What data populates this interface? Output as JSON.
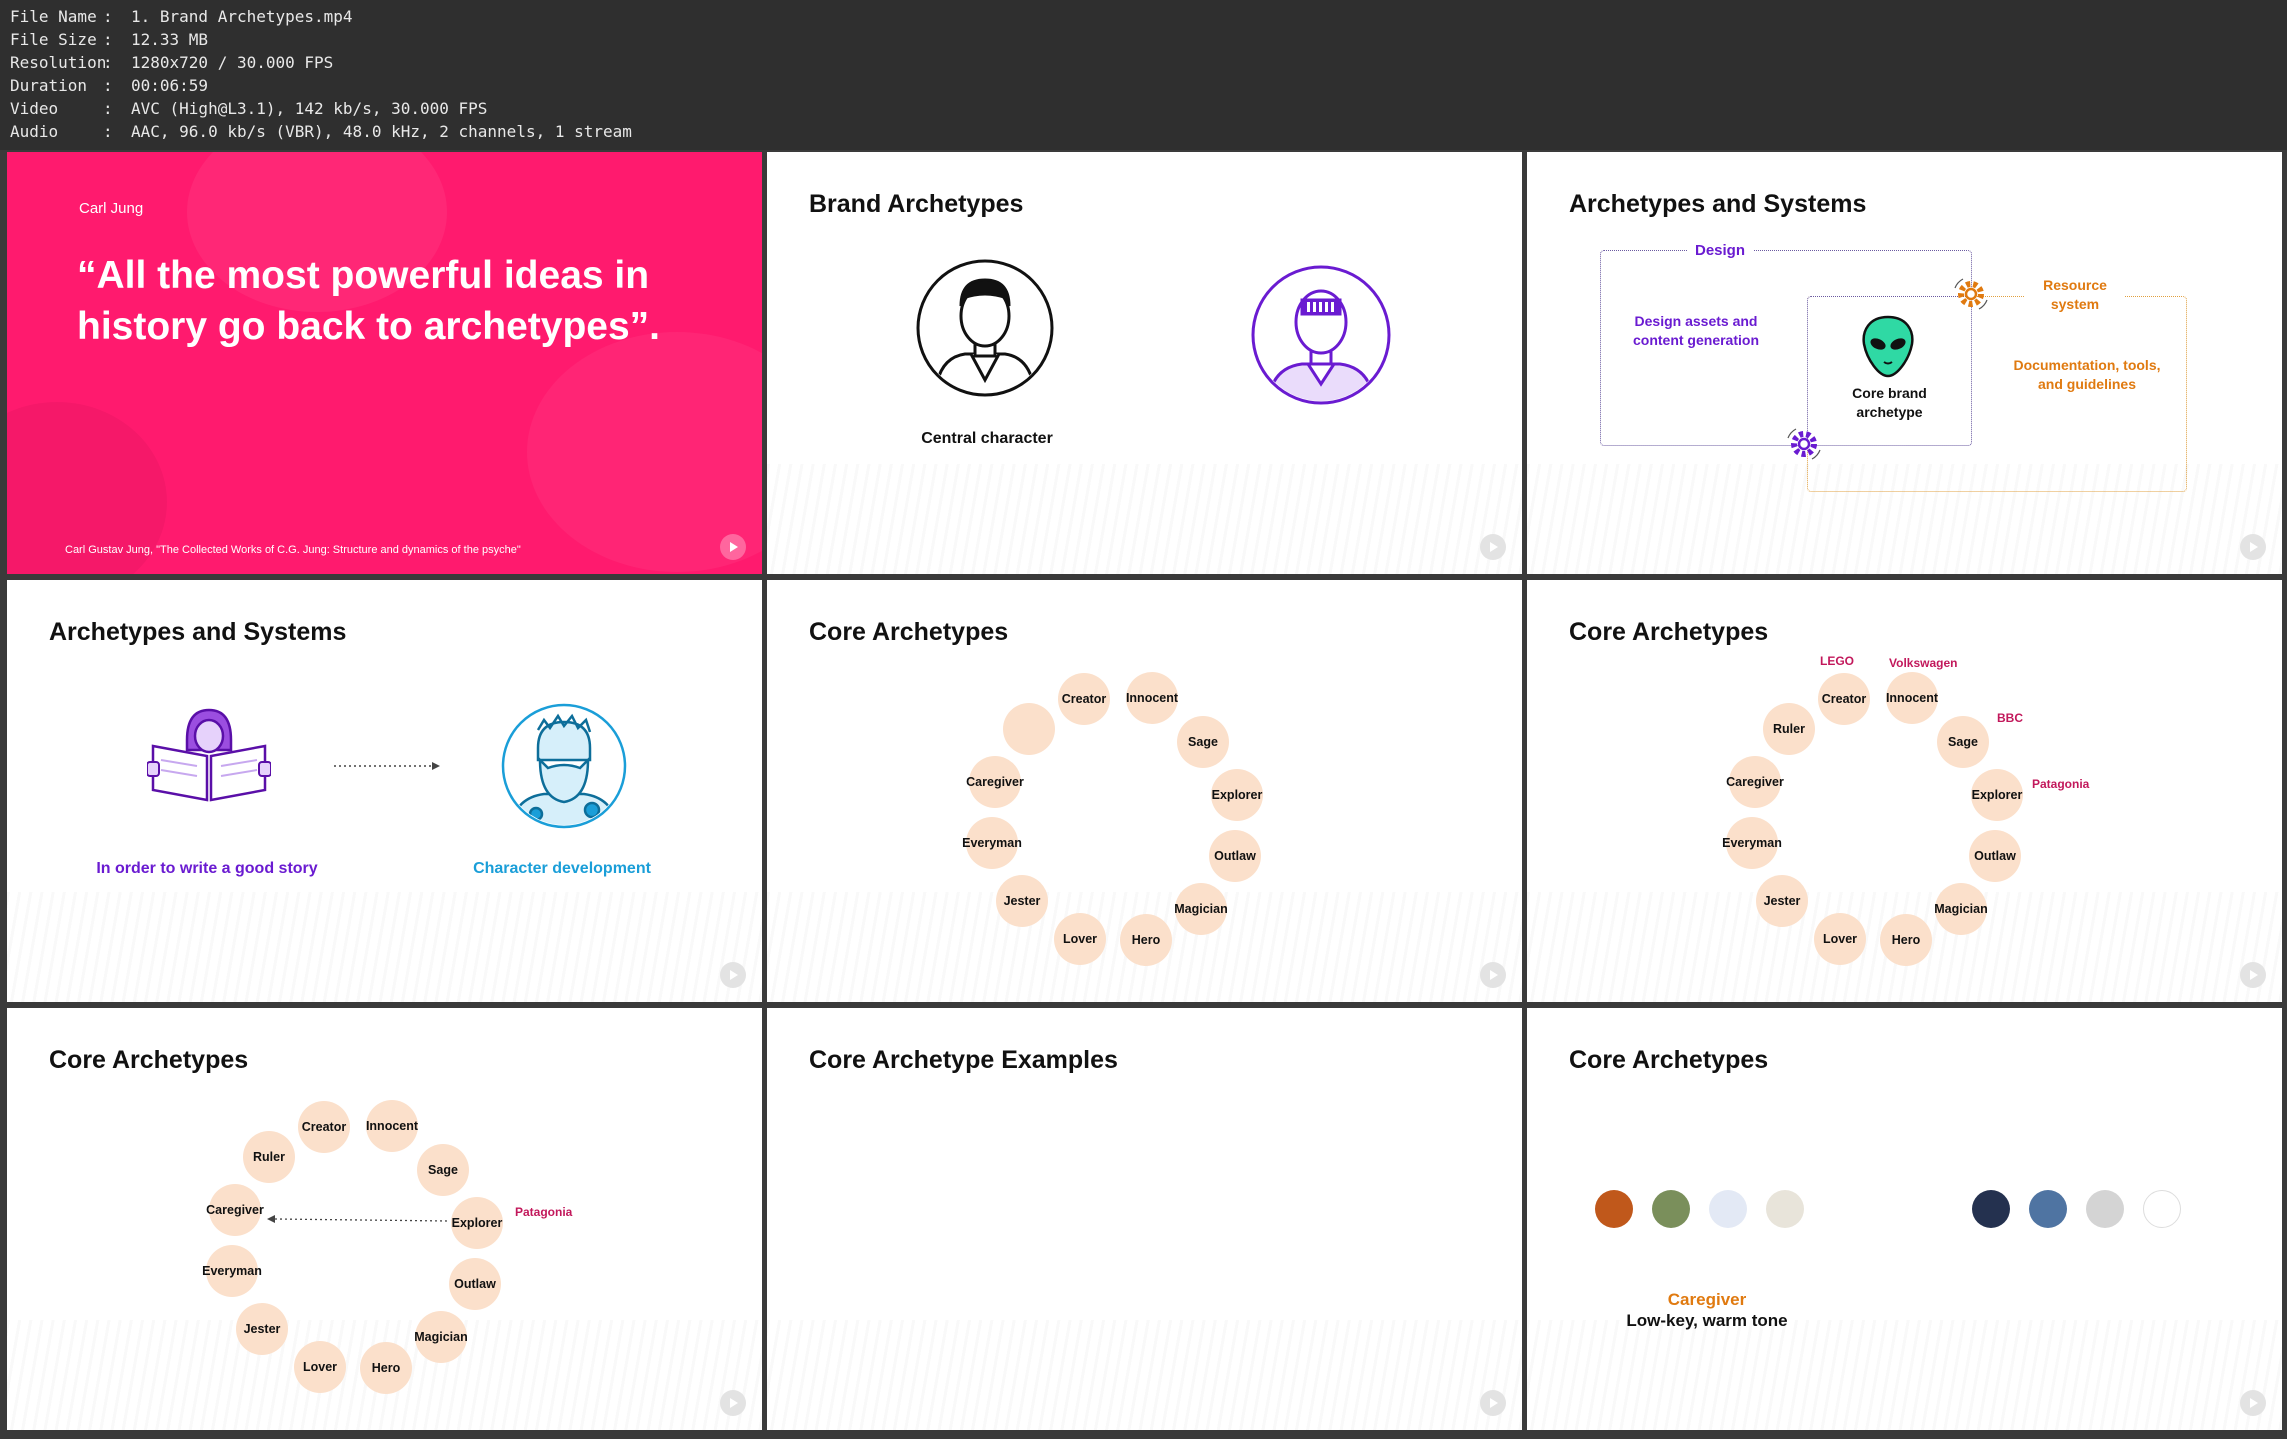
{
  "info": [
    {
      "key": "File Name",
      "value": "1. Brand Archetypes.mp4"
    },
    {
      "key": "File Size",
      "value": "12.33 MB"
    },
    {
      "key": "Resolution",
      "value": "1280x720 / 30.000 FPS"
    },
    {
      "key": "Duration",
      "value": "00:06:59"
    },
    {
      "key": "Video",
      "value": "AVC (High@L3.1), 142 kb/s, 30.000 FPS"
    },
    {
      "key": "Audio",
      "value": "AAC, 96.0 kb/s (VBR), 48.0 kHz, 2 channels, 1 stream"
    }
  ],
  "colors": {
    "pink": "#ff1a6e",
    "purple": "#6a1bd1",
    "orange": "#e07a10",
    "blue": "#1a9ed8",
    "node": "#fbe0cb",
    "brand": "#c2185b"
  },
  "t1": {
    "author": "Carl Jung",
    "quote": "“All the most powerful ideas in history go back to archetypes”.",
    "citation": "Carl Gustav Jung, \"The Collected Works of C.G. Jung: Structure and dynamics of the psyche\""
  },
  "t2": {
    "title": "Brand Archetypes",
    "caption": "Central character"
  },
  "t3": {
    "title": "Archetypes and Systems",
    "design": "Design",
    "design_assets": "Design assets and content generation",
    "core": "Core brand archetype",
    "resource": "Resource system",
    "docs": "Documentation, tools, and guidelines"
  },
  "t4": {
    "title": "Archetypes and Systems",
    "left": "In order to write a good story",
    "right": "Character development"
  },
  "t5": {
    "title": "Core Archetypes"
  },
  "t6": {
    "title": "Core Archetypes",
    "brands": {
      "lego": "LEGO",
      "vw": "Volkswagen",
      "bbc": "BBC",
      "patagonia": "Patagonia"
    }
  },
  "t7": {
    "title": "Core Archetypes",
    "brand": "Patagonia"
  },
  "t8": {
    "title": "Core Archetype Examples"
  },
  "t9": {
    "title": "Core Archetypes",
    "label": "Caregiver",
    "sub": "Low-key, warm tone",
    "swatches_left": [
      "#c0581b",
      "#7a8f5b",
      "#e3e9f5",
      "#e8e4da"
    ],
    "swatches_right": [
      "#24314f",
      "#4f74a2",
      "#d4d4d4",
      "#ffffff"
    ]
  },
  "archetypes": {
    "creator": "Creator",
    "innocent": "Innocent",
    "sage": "Sage",
    "explorer": "Explorer",
    "outlaw": "Outlaw",
    "magician": "Magician",
    "hero": "Hero",
    "lover": "Lover",
    "jester": "Jester",
    "everyman": "Everyman",
    "caregiver": "Caregiver",
    "ruler": "Ruler"
  }
}
